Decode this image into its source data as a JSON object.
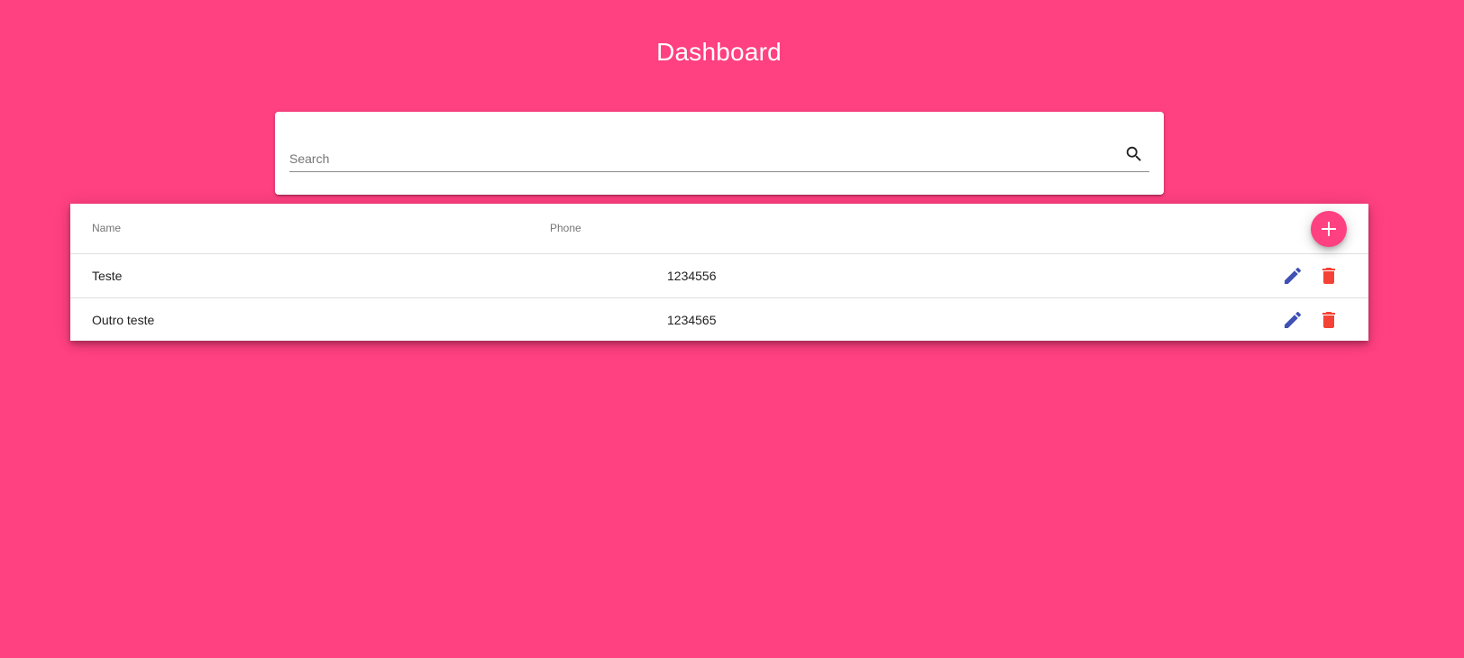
{
  "header": {
    "title": "Dashboard"
  },
  "search": {
    "placeholder": "Search",
    "value": "",
    "icon": "search-icon"
  },
  "table": {
    "columns": {
      "name": "Name",
      "phone": "Phone"
    },
    "add_icon": "plus-icon",
    "rows": [
      {
        "name": "Teste",
        "phone": "1234556",
        "edit_icon": "pencil-icon",
        "delete_icon": "trash-icon"
      },
      {
        "name": "Outro teste",
        "phone": "1234565",
        "edit_icon": "pencil-icon",
        "delete_icon": "trash-icon"
      }
    ]
  },
  "colors": {
    "background": "#ff4081",
    "accent": "#ff4081",
    "edit": "#3f51b5",
    "delete": "#f44336"
  }
}
